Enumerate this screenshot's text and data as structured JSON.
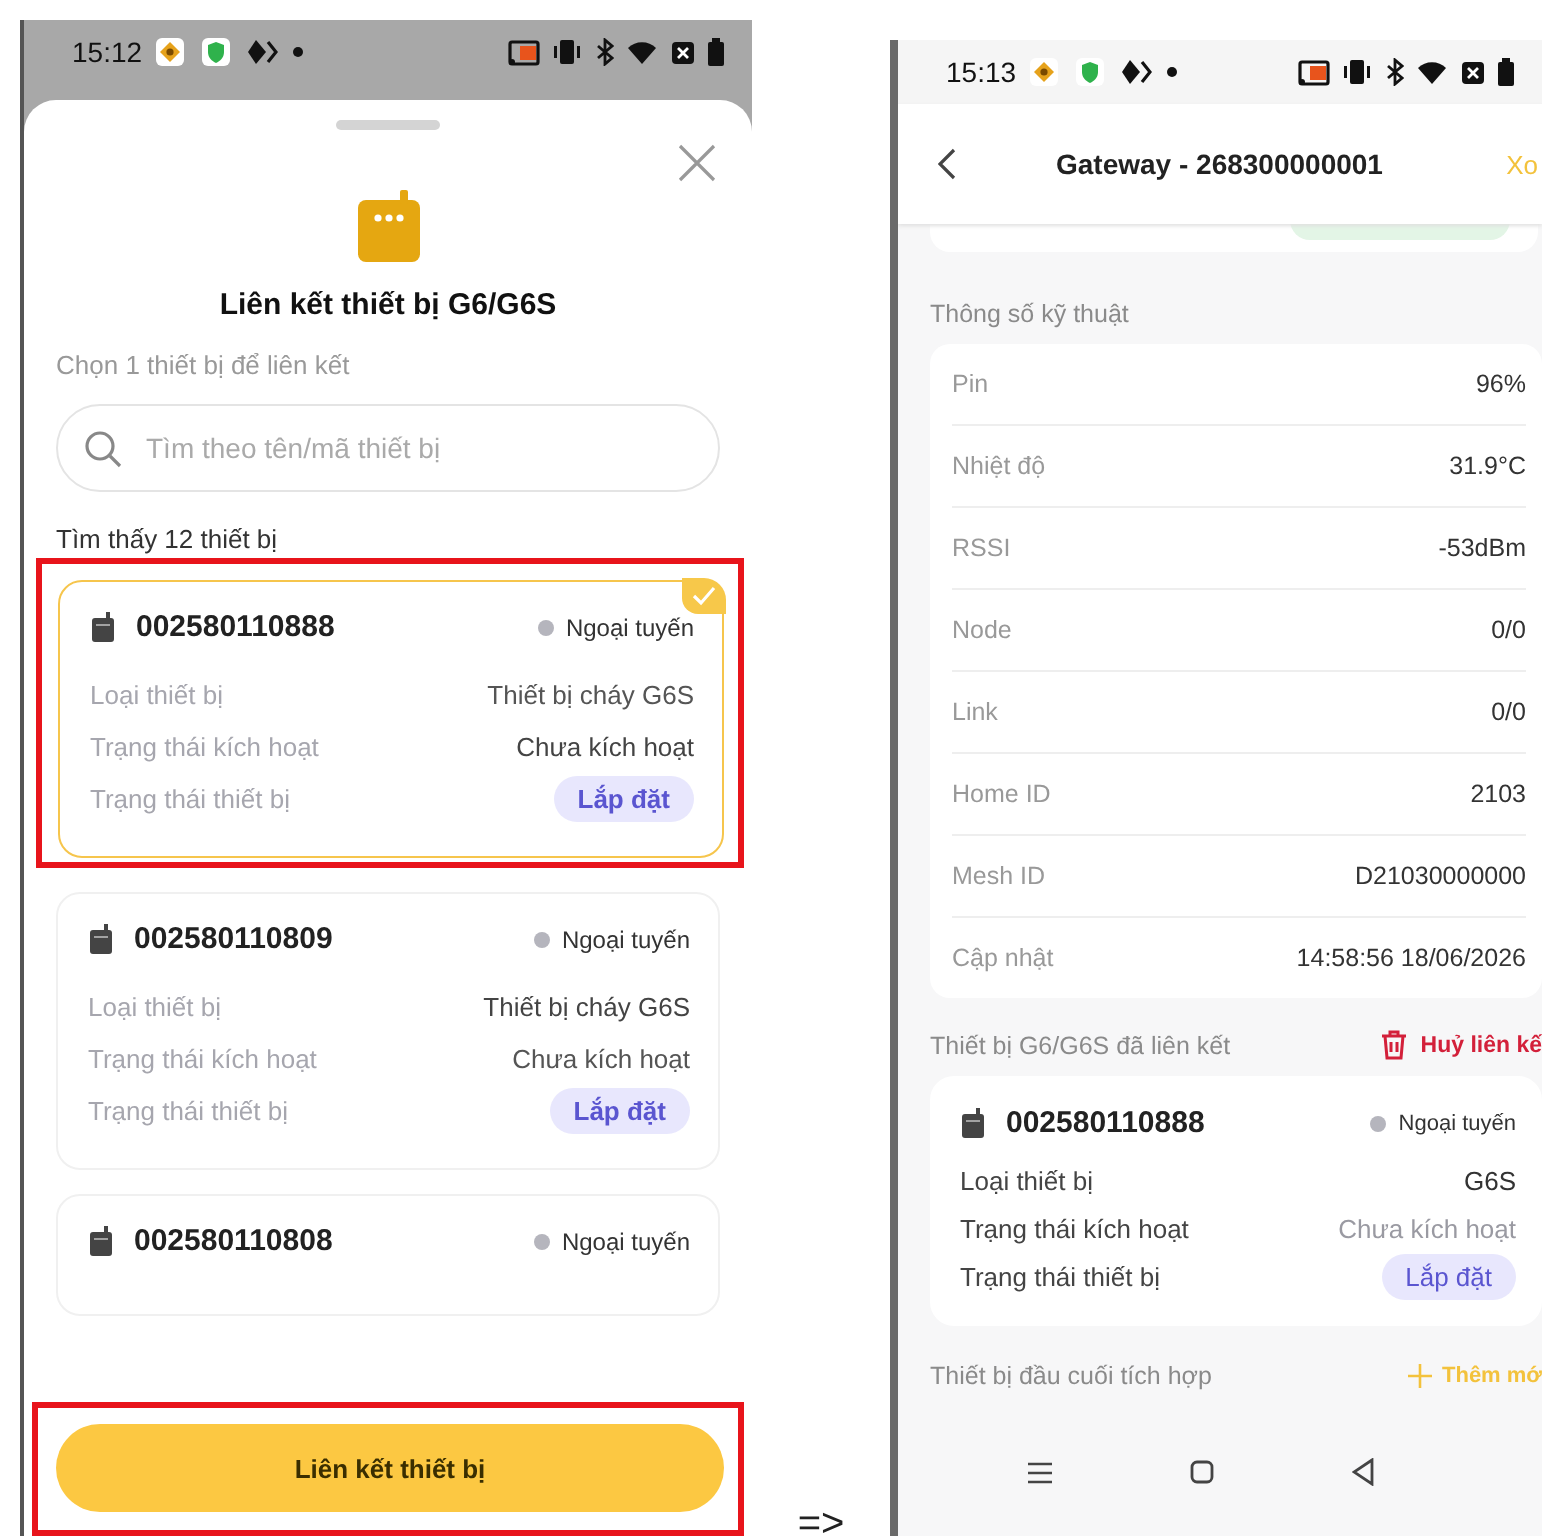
{
  "left_screen": {
    "status_bar": {
      "time": "15:12"
    },
    "sheet": {
      "title": "Liên kết thiết bị G6/G6S",
      "instruction": "Chọn 1 thiết bị để liên kết",
      "search": {
        "placeholder": "Tìm theo tên/mã thiết bị"
      },
      "result_count": "Tìm thấy 12 thiết bị",
      "devices": [
        {
          "code": "002580110888",
          "status": "Ngoại tuyến",
          "selected": true,
          "highlighted": true,
          "rows": [
            {
              "label": "Loại thiết bị",
              "value": "Thiết bị cháy G6S"
            },
            {
              "label": "Trạng thái kích hoạt",
              "value": "Chưa kích hoạt"
            },
            {
              "label": "Trạng thái thiết bị",
              "badge": "Lắp đặt"
            }
          ]
        },
        {
          "code": "002580110809",
          "status": "Ngoại tuyến",
          "selected": false,
          "highlighted": false,
          "rows": [
            {
              "label": "Loại thiết bị",
              "value": "Thiết bị cháy G6S"
            },
            {
              "label": "Trạng thái kích hoạt",
              "value": "Chưa kích hoạt"
            },
            {
              "label": "Trạng thái thiết bị",
              "badge": "Lắp đặt"
            }
          ]
        },
        {
          "code": "002580110808",
          "status": "Ngoại tuyến",
          "selected": false,
          "highlighted": false
        }
      ],
      "confirm_button": {
        "label": "Liên kết thiết bị",
        "highlighted": true
      }
    }
  },
  "arrow": "=>",
  "right_screen": {
    "status_bar": {
      "time": "15:13"
    },
    "header": {
      "title": "Gateway - 268300000001",
      "action": "Xo"
    },
    "specs_title": "Thông số kỹ thuật",
    "specs": [
      {
        "label": "Pin",
        "value": "96%"
      },
      {
        "label": "Nhiệt độ",
        "value": "31.9°C"
      },
      {
        "label": "RSSI",
        "value": "-53dBm"
      },
      {
        "label": "Node",
        "value": "0/0"
      },
      {
        "label": "Link",
        "value": "0/0"
      },
      {
        "label": "Home ID",
        "value": "2103"
      },
      {
        "label": "Mesh ID",
        "value": "D21030000000"
      },
      {
        "label": "Cập nhật",
        "value": "14:58:56 18/06/2026"
      }
    ],
    "linked_title": "Thiết bị G6/G6S đã liên kết",
    "unlink": "Huỷ liên kế",
    "linked_device": {
      "code": "002580110888",
      "status": "Ngoại tuyến",
      "rows": [
        {
          "label": "Loại thiết bị",
          "value": "G6S"
        },
        {
          "label": "Trạng thái kích hoạt",
          "value": "Chưa kích hoạt"
        },
        {
          "label": "Trạng thái thiết bị",
          "badge": "Lắp đặt"
        }
      ]
    },
    "terminal_title": "Thiết bị đầu cuối tích hợp",
    "add": "Thêm mớ"
  }
}
